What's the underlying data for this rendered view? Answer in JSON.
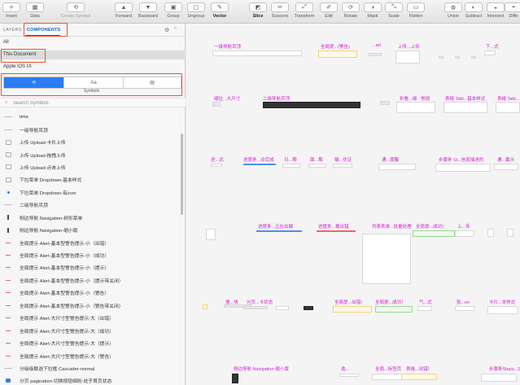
{
  "toolbar": {
    "items": [
      {
        "label": "Insert",
        "icon": "plus-icon",
        "state": "normal"
      },
      {
        "label": "Data",
        "icon": "data-icon",
        "state": "normal"
      },
      {
        "label": "Create Symbol",
        "icon": "create-symbol-icon",
        "state": "disabled"
      },
      {
        "label": "Forward",
        "icon": "forward-icon",
        "state": "normal"
      },
      {
        "label": "Backward",
        "icon": "backward-icon",
        "state": "normal"
      },
      {
        "label": "Group",
        "icon": "group-icon",
        "state": "normal"
      },
      {
        "label": "Ungroup",
        "icon": "ungroup-icon",
        "state": "normal"
      },
      {
        "label": "Vector",
        "icon": "vector-icon",
        "state": "bold"
      },
      {
        "label": "Slice",
        "icon": "slice-icon",
        "state": "bold"
      },
      {
        "label": "Scissors",
        "icon": "scissors-icon",
        "state": "normal"
      },
      {
        "label": "Transform",
        "icon": "transform-icon",
        "state": "normal"
      },
      {
        "label": "Edit",
        "icon": "edit-icon",
        "state": "normal"
      },
      {
        "label": "Rotate",
        "icon": "rotate-icon",
        "state": "normal"
      },
      {
        "label": "Mask",
        "icon": "mask-icon",
        "state": "normal"
      },
      {
        "label": "Scale",
        "icon": "scale-icon",
        "state": "normal"
      },
      {
        "label": "Flatten",
        "icon": "flatten-icon",
        "state": "normal"
      },
      {
        "label": "Union",
        "icon": "union-icon",
        "state": "normal"
      },
      {
        "label": "Subtract",
        "icon": "subtract-icon",
        "state": "normal"
      },
      {
        "label": "Intersect",
        "icon": "intersect-icon",
        "state": "normal"
      },
      {
        "label": "Diffe",
        "icon": "difference-icon",
        "state": "normal"
      }
    ]
  },
  "sidebar": {
    "tabs": [
      {
        "label": "LAYERS",
        "active": false
      },
      {
        "label": "COMPONENTS",
        "active": true
      }
    ],
    "gear_icon": "gear-icon",
    "libraries": [
      {
        "label": "All",
        "selected": false
      },
      {
        "label": "This Document",
        "selected": true
      },
      {
        "label": "Apple iOS UI",
        "selected": false
      }
    ],
    "segments": [
      {
        "label": "⟲",
        "icon": "symbols-icon",
        "active": true
      },
      {
        "label": "Aa",
        "icon": "text-styles-icon",
        "active": false
      },
      {
        "label": "▤",
        "icon": "layer-styles-icon",
        "active": false
      }
    ],
    "segment_caption": "Symbols",
    "search": {
      "placeholder": "Search Symbols",
      "value": ""
    },
    "symbols": [
      {
        "name": "time",
        "thumb": "line"
      },
      {
        "name": "一级导航吊顶",
        "thumb": "line"
      },
      {
        "name": "上传 Upload-卡片上传",
        "thumb": "box"
      },
      {
        "name": "上传 Upload-拖拽上传",
        "thumb": "box"
      },
      {
        "name": "上传 Upload-点击上传",
        "thumb": "box"
      },
      {
        "name": "下拉菜单 Dropdown-基本样式",
        "thumb": "box"
      },
      {
        "name": "下拉菜单 Dropdown-有icon",
        "thumb": "dot"
      },
      {
        "name": "二级导航吊顶",
        "thumb": "line"
      },
      {
        "name": "侧边导航 Navigation-树形菜单",
        "thumb": "bar"
      },
      {
        "name": "侧边导航 Navigation-缩小版",
        "thumb": "bar"
      },
      {
        "name": "全局提示 Alert-基本型警告提示-小（出错）",
        "thumb": "dash"
      },
      {
        "name": "全局提示 Alert-基本型警告提示-小（成功）",
        "thumb": "dash"
      },
      {
        "name": "全局提示 Alert-基本型警告提示-小（提示）",
        "thumb": "dash"
      },
      {
        "name": "全局提示 Alert-基本型警告提示-小（提示带关闭）",
        "thumb": "dash"
      },
      {
        "name": "全局提示 Alert-基本型警告提示-小（警告）",
        "thumb": "dash"
      },
      {
        "name": "全局提示 Alert-基本型警告提示-小（警告带关闭）",
        "thumb": "dash"
      },
      {
        "name": "全局提示 Alert-大尺寸型警告提示-大（出错）",
        "thumb": "dash"
      },
      {
        "name": "全局提示 Alert-大尺寸型警告提示-大（成功）",
        "thumb": "dash"
      },
      {
        "name": "全局提示 Alert-大尺寸型警告提示-大（提示）",
        "thumb": "dash"
      },
      {
        "name": "全局提示 Alert-大尺寸型警告提示-大（警告）",
        "thumb": "dash"
      },
      {
        "name": "分级级联选下拉框 Cascader-normal",
        "thumb": "line"
      },
      {
        "name": "分页 pagination-切换按钮细则-处于首页状态",
        "thumb": "blue"
      }
    ]
  },
  "canvas": {
    "artboards": [
      "一级导航吊顶",
      "全局提...(警告)",
      "...art",
      "上传...上传",
      "下...式",
      "缝拉...大尺寸",
      "二级导航吊顶",
      "折叠...细 · 常规",
      "表格 Tabl...基本样式",
      "表格 Tabl...",
      "进...式",
      "进度条...动完成",
      "日...期",
      "面...期",
      "输...仿证",
      "通...度醒",
      "步骤条 St...信息描述的",
      "通...截示",
      "进度条...正在出载",
      "进度条...载出错",
      "列表表单...批量处理",
      "全局提...成功）",
      "上...传",
      "搜...块",
      "分页...卡状态",
      "全局提...出错）",
      "全局提...成功）",
      "气...式",
      "张...en",
      "卡片...本样式",
      "侧边导航 Navigation-缩小版",
      "选...",
      "全局...标签页",
      "表格...出错）",
      "步骤条Steps...式（迹"
    ],
    "colors": {
      "artboard_label": "#cc1fcc",
      "accent": "#2b7cf0",
      "highlight": "#e8552c"
    }
  }
}
